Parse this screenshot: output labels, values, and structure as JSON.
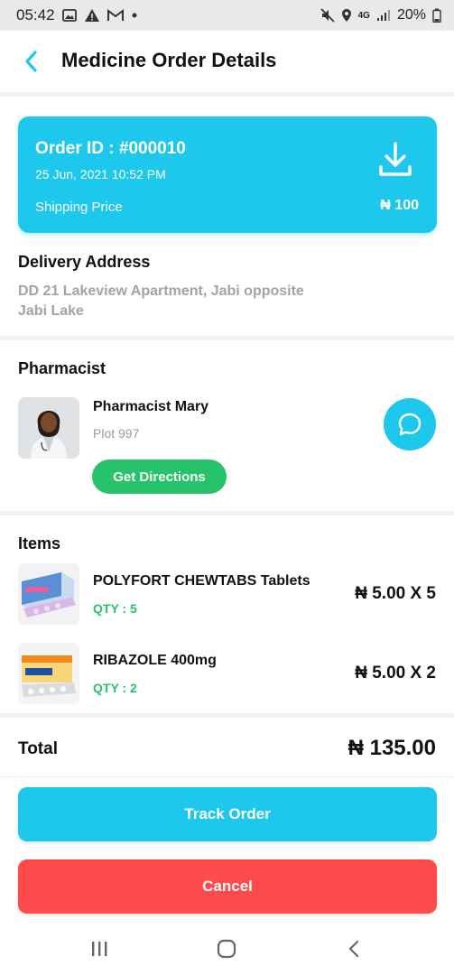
{
  "status_bar": {
    "time": "05:42",
    "network": "4G",
    "battery": "20%",
    "icons_left": [
      "image-icon",
      "warning-icon",
      "gmail-icon",
      "dot-icon"
    ],
    "icons_right": [
      "mute-icon",
      "location-icon",
      "signal-icon"
    ]
  },
  "header": {
    "title": "Medicine Order Details",
    "back_icon": "chevron-left-icon"
  },
  "order": {
    "id_text": "Order ID : #000010",
    "date": "25 Jun, 2021 10:52 PM",
    "shipping_label": "Shipping Price",
    "shipping_price": "₦ 100",
    "download_icon": "download-icon"
  },
  "delivery": {
    "title": "Delivery Address",
    "address": "DD 21 Lakeview Apartment, Jabi opposite Jabi Lake"
  },
  "pharmacist": {
    "section_title": "Pharmacist",
    "name": "Pharmacist Mary",
    "plot": "Plot 997",
    "directions_label": "Get Directions",
    "chat_icon": "chat-bubble-icon"
  },
  "items": {
    "section_title": "Items",
    "list": [
      {
        "name": "POLYFORT CHEWTABS Tablets",
        "qty": "QTY : 5",
        "price": "₦ 5.00 X 5"
      },
      {
        "name": "RIBAZOLE 400mg",
        "qty": "QTY : 2",
        "price": "₦ 5.00 X 2"
      }
    ]
  },
  "total": {
    "label": "Total",
    "value": "₦ 135.00"
  },
  "actions": {
    "track_label": "Track Order",
    "cancel_label": "Cancel"
  },
  "nav_bar": {
    "icons": [
      "recent-apps-icon",
      "home-icon",
      "back-nav-icon"
    ]
  },
  "colors": {
    "accent": "#1ec8ec",
    "green": "#27c36a",
    "danger": "#ff4b4b",
    "muted": "#a3a3a3"
  }
}
